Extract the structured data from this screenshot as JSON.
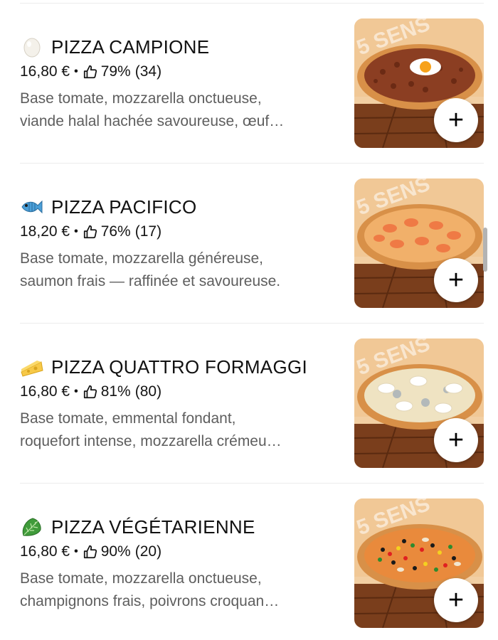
{
  "items": [
    {
      "emoji": "egg-icon",
      "title": "PIZZA CAMPIONE",
      "price": "16,80 €",
      "rating_pct": "79%",
      "rating_count": "(34)",
      "desc_line1": "Base tomate, mozzarella onctueuse,",
      "desc_line2": "viande halal hachée savoureuse, œuf…",
      "add_label": "+"
    },
    {
      "emoji": "fish-icon",
      "title": "PIZZA PACIFICO",
      "price": "18,20 €",
      "rating_pct": "76%",
      "rating_count": "(17)",
      "desc_line1": "Base tomate, mozzarella généreuse,",
      "desc_line2": "saumon frais — raffinée et savoureuse.",
      "add_label": "+"
    },
    {
      "emoji": "cheese-icon",
      "title": "PIZZA QUATTRO FORMAGGI",
      "price": "16,80 €",
      "rating_pct": "81%",
      "rating_count": "(80)",
      "desc_line1": "Base tomate, emmental fondant,",
      "desc_line2": "roquefort intense, mozzarella crémeu…",
      "add_label": "+"
    },
    {
      "emoji": "lettuce-icon",
      "title": "PIZZA VÉGÉTARIENNE",
      "price": "16,80 €",
      "rating_pct": "90%",
      "rating_count": "(20)",
      "desc_line1": "Base tomate, mozzarella onctueuse,",
      "desc_line2": "champignons frais, poivrons croquan…",
      "add_label": "+"
    }
  ],
  "meta_separator": "•",
  "colors": {
    "text": "#111111",
    "secondary_text": "#5e5e5e",
    "divider": "#ececec",
    "image_background": "#f0c99a"
  }
}
